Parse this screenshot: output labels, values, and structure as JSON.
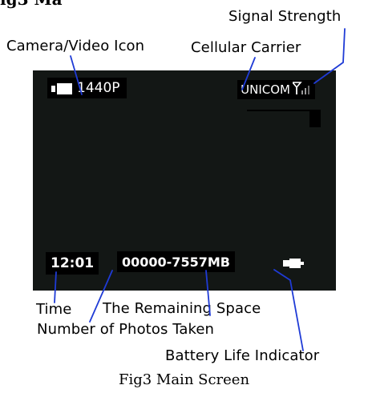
{
  "header_fragment": "ig3 Ma",
  "callouts": {
    "signal_strength": "Signal Strength",
    "camera_video_icon": "Camera/Video Icon",
    "cellular_carrier": "Cellular Carrier",
    "time": "Time",
    "remaining_space": "The Remaining Space",
    "photos_taken": "Number of Photos Taken",
    "battery_life": "Battery Life Indicator"
  },
  "screen": {
    "resolution": "1440P",
    "carrier": "UNICOM",
    "time": "12:01",
    "photos_and_space": "00000-7557MB"
  },
  "caption": "Fig3 Main Screen",
  "icons": [
    "camera-icon",
    "signal-antenna-icon",
    "battery-icon"
  ],
  "colors": {
    "screen_bg": "#131715",
    "leader_line": "#1f3bd6",
    "label_bg": "#000000",
    "label_text": "#ffffff"
  }
}
